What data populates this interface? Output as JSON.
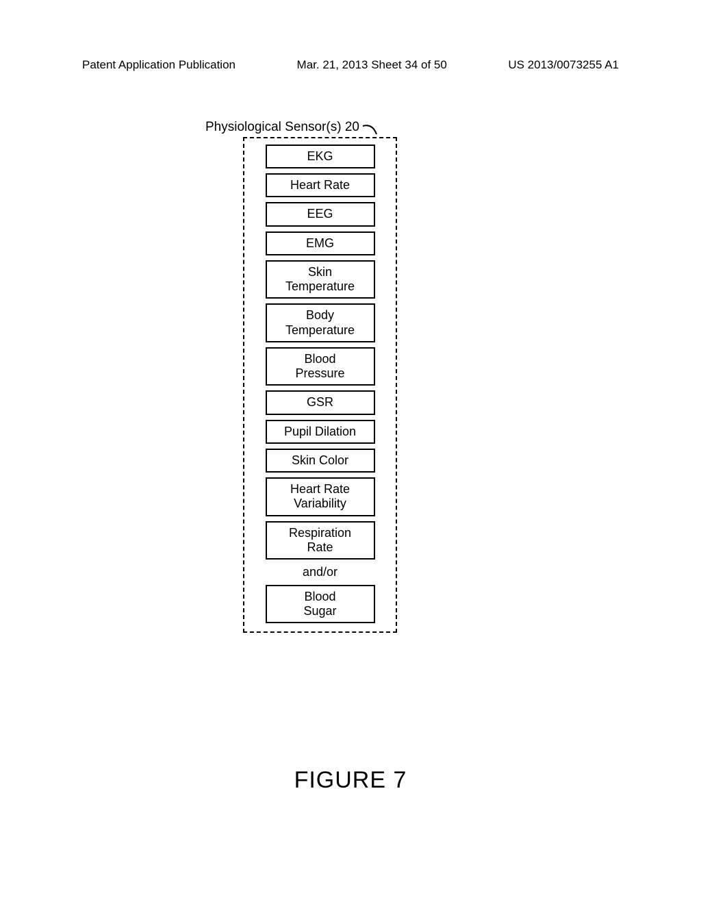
{
  "header": {
    "left": "Patent Application Publication",
    "center": "Mar. 21, 2013  Sheet 34 of 50",
    "right": "US 2013/0073255 A1"
  },
  "diagram": {
    "title_text": "Physiological Sensor(s) ",
    "title_ref": "20",
    "connector": "and/or",
    "boxes": [
      {
        "label": "EKG"
      },
      {
        "label": "Heart Rate"
      },
      {
        "label": "EEG"
      },
      {
        "label": "EMG"
      },
      {
        "label": "Skin\nTemperature"
      },
      {
        "label": "Body\nTemperature"
      },
      {
        "label": "Blood\nPressure"
      },
      {
        "label": "GSR"
      },
      {
        "label": "Pupil Dilation"
      },
      {
        "label": "Skin Color"
      },
      {
        "label": "Heart Rate\nVariability"
      },
      {
        "label": "Respiration\nRate"
      }
    ],
    "last_box": {
      "label": "Blood\nSugar"
    }
  },
  "figure_caption": "FIGURE 7"
}
